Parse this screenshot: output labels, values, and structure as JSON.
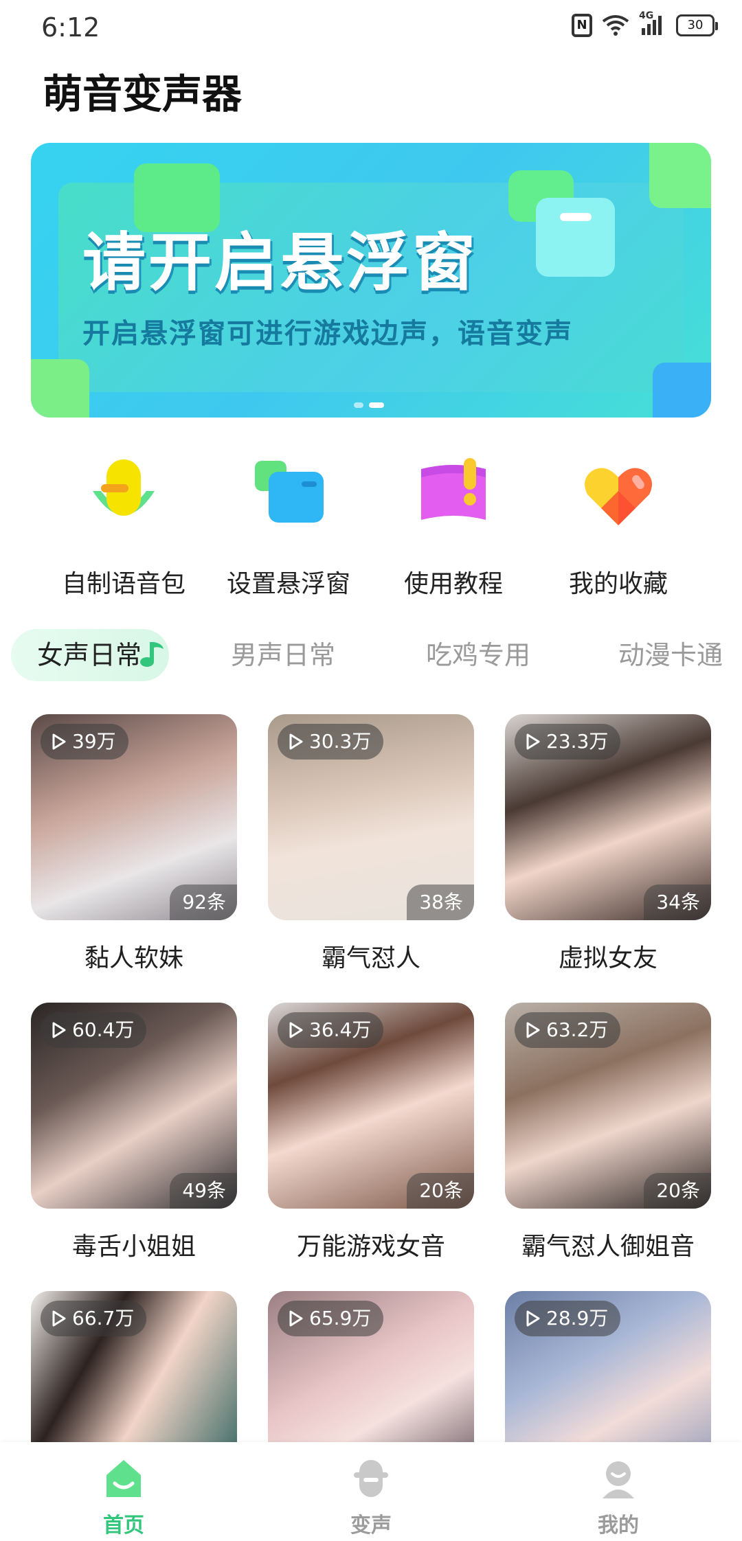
{
  "status_bar": {
    "time": "6:12",
    "network": "4G",
    "battery": "30"
  },
  "app": {
    "title": "萌音变声器"
  },
  "banner": {
    "headline": "请开启悬浮窗",
    "subtitle": "开启悬浮窗可进行游戏边声，语音变声",
    "active_dot": 1
  },
  "quick_actions": [
    {
      "label": "自制语音包",
      "icon": "microphone-icon"
    },
    {
      "label": "设置悬浮窗",
      "icon": "floating-window-icon"
    },
    {
      "label": "使用教程",
      "icon": "tutorial-book-icon"
    },
    {
      "label": "我的收藏",
      "icon": "heart-icon"
    }
  ],
  "tabs": [
    {
      "label": "女声日常",
      "active": true
    },
    {
      "label": "男声日常",
      "active": false
    },
    {
      "label": "吃鸡专用",
      "active": false
    },
    {
      "label": "动漫卡通",
      "active": false
    }
  ],
  "cards": [
    {
      "plays": "39万",
      "count": "92条",
      "title": "黏人软妹"
    },
    {
      "plays": "30.3万",
      "count": "38条",
      "title": "霸气怼人"
    },
    {
      "plays": "23.3万",
      "count": "34条",
      "title": "虚拟女友"
    },
    {
      "plays": "60.4万",
      "count": "49条",
      "title": "毒舌小姐姐"
    },
    {
      "plays": "36.4万",
      "count": "20条",
      "title": "万能游戏女音"
    },
    {
      "plays": "63.2万",
      "count": "20条",
      "title": "霸气怼人御姐音"
    },
    {
      "plays": "66.7万"
    },
    {
      "plays": "65.9万"
    },
    {
      "plays": "28.9万"
    }
  ],
  "bottom_nav": [
    {
      "label": "首页",
      "icon": "home-icon",
      "active": true
    },
    {
      "label": "变声",
      "icon": "voice-change-icon",
      "active": false
    },
    {
      "label": "我的",
      "icon": "profile-icon",
      "active": false
    }
  ],
  "colors": {
    "accent": "#32c67d",
    "banner_start": "#36d3f0",
    "banner_end": "#46e0d5",
    "inactive_tab": "#9a9a9a"
  }
}
